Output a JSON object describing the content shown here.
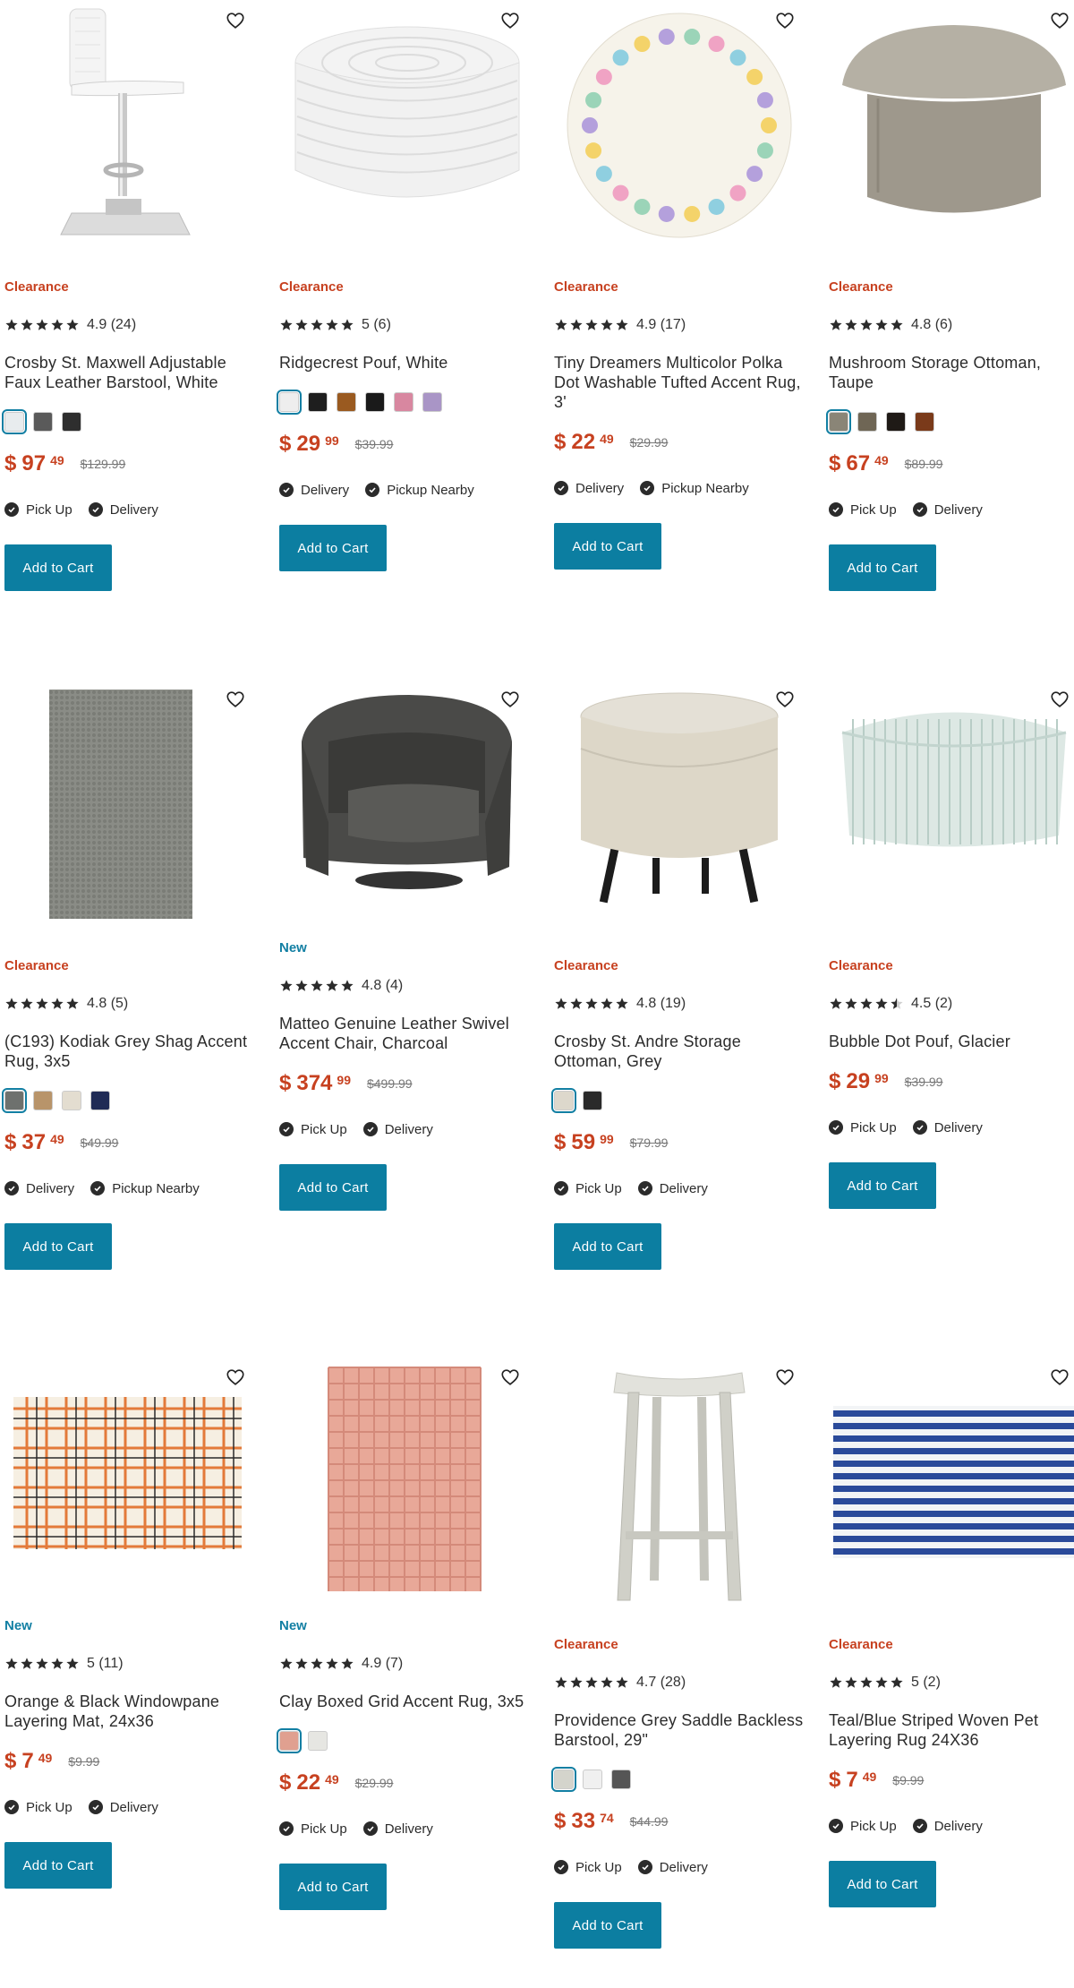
{
  "products": [
    {
      "badge": "Clearance",
      "badge_type": "clearance",
      "rating": "4.9 (24)",
      "stars": 5,
      "title": "Crosby St. Maxwell Adjustable Faux Leather Barstool, White",
      "swatches": [
        "#e8ecee",
        "#5a5a5a",
        "#2e2e2e"
      ],
      "price_dollar": "$",
      "price_whole": "97",
      "price_cents": "49",
      "was_price": "$129.99",
      "fulfillment": [
        "Pick Up",
        "Delivery"
      ],
      "cart_label": "Add to Cart",
      "image": "barstool-white"
    },
    {
      "badge": "Clearance",
      "badge_type": "clearance",
      "rating": "5 (6)",
      "stars": 5,
      "title": "Ridgecrest Pouf, White",
      "swatches": [
        "#eeeeee",
        "#1e1e1e",
        "#9a5a20",
        "#1a1a1a",
        "#d887a0",
        "#a995c6"
      ],
      "price_dollar": "$",
      "price_whole": "29",
      "price_cents": "99",
      "was_price": "$39.99",
      "fulfillment": [
        "Delivery",
        "Pickup Nearby"
      ],
      "cart_label": "Add to Cart",
      "image": "pouf-white"
    },
    {
      "badge": "Clearance",
      "badge_type": "clearance",
      "rating": "4.9 (17)",
      "stars": 5,
      "title": "Tiny Dreamers Multicolor Polka Dot Washable Tufted Accent Rug, 3'",
      "swatches": [],
      "price_dollar": "$",
      "price_whole": "22",
      "price_cents": "49",
      "was_price": "$29.99",
      "fulfillment": [
        "Delivery",
        "Pickup Nearby"
      ],
      "cart_label": "Add to Cart",
      "image": "rug-polka"
    },
    {
      "badge": "Clearance",
      "badge_type": "clearance",
      "rating": "4.8 (6)",
      "stars": 5,
      "title": "Mushroom Storage Ottoman, Taupe",
      "swatches": [
        "#8a8577",
        "#6f6655",
        "#1f1a16",
        "#7a3a1a"
      ],
      "price_dollar": "$",
      "price_whole": "67",
      "price_cents": "49",
      "was_price": "$89.99",
      "fulfillment": [
        "Pick Up",
        "Delivery"
      ],
      "cart_label": "Add to Cart",
      "image": "ottoman-mushroom"
    },
    {
      "badge": "Clearance",
      "badge_type": "clearance",
      "rating": "4.8 (5)",
      "stars": 5,
      "title": "(C193) Kodiak Grey Shag Accent Rug, 3x5",
      "swatches": [
        "#6e716e",
        "#b8946a",
        "#e3ddd0",
        "#1f2b55"
      ],
      "price_dollar": "$",
      "price_whole": "37",
      "price_cents": "49",
      "was_price": "$49.99",
      "fulfillment": [
        "Delivery",
        "Pickup Nearby"
      ],
      "cart_label": "Add to Cart",
      "image": "rug-shag"
    },
    {
      "badge": "New",
      "badge_type": "new",
      "rating": "4.8 (4)",
      "stars": 5,
      "title": "Matteo Genuine Leather Swivel Accent Chair, Charcoal",
      "swatches": [],
      "price_dollar": "$",
      "price_whole": "374",
      "price_cents": "99",
      "was_price": "$499.99",
      "fulfillment": [
        "Pick Up",
        "Delivery"
      ],
      "cart_label": "Add to Cart",
      "image": "chair-leather"
    },
    {
      "badge": "Clearance",
      "badge_type": "clearance",
      "rating": "4.8 (19)",
      "stars": 5,
      "title": "Crosby St. Andre Storage Ottoman, Grey",
      "swatches": [
        "#ddd8cc",
        "#2a2a2a"
      ],
      "price_dollar": "$",
      "price_whole": "59",
      "price_cents": "99",
      "was_price": "$79.99",
      "fulfillment": [
        "Pick Up",
        "Delivery"
      ],
      "cart_label": "Add to Cart",
      "image": "ottoman-andre"
    },
    {
      "badge": "Clearance",
      "badge_type": "clearance",
      "rating": "4.5 (2)",
      "stars": 4.5,
      "title": "Bubble Dot Pouf, Glacier",
      "swatches": [],
      "price_dollar": "$",
      "price_whole": "29",
      "price_cents": "99",
      "was_price": "$39.99",
      "fulfillment": [
        "Pick Up",
        "Delivery"
      ],
      "cart_label": "Add to Cart",
      "image": "pouf-glacier"
    },
    {
      "badge": "New",
      "badge_type": "new",
      "rating": "5 (11)",
      "stars": 5,
      "title": "Orange & Black Windowpane Layering Mat, 24x36",
      "swatches": [],
      "price_dollar": "$",
      "price_whole": "7",
      "price_cents": "49",
      "was_price": "$9.99",
      "fulfillment": [
        "Pick Up",
        "Delivery"
      ],
      "cart_label": "Add to Cart",
      "image": "mat-windowpane"
    },
    {
      "badge": "New",
      "badge_type": "new",
      "rating": "4.9 (7)",
      "stars": 5,
      "title": "Clay Boxed Grid Accent Rug, 3x5",
      "swatches": [
        "#e0a090",
        "#e6e6e2"
      ],
      "price_dollar": "$",
      "price_whole": "22",
      "price_cents": "49",
      "was_price": "$29.99",
      "fulfillment": [
        "Pick Up",
        "Delivery"
      ],
      "cart_label": "Add to Cart",
      "image": "rug-clay"
    },
    {
      "badge": "Clearance",
      "badge_type": "clearance",
      "rating": "4.7 (28)",
      "stars": 5,
      "title": "Providence Grey Saddle Backless Barstool, 29\"",
      "swatches": [
        "#d4d4cc",
        "#f0f0f0",
        "#555555"
      ],
      "price_dollar": "$",
      "price_whole": "33",
      "price_cents": "74",
      "was_price": "$44.99",
      "fulfillment": [
        "Pick Up",
        "Delivery"
      ],
      "cart_label": "Add to Cart",
      "image": "barstool-saddle"
    },
    {
      "badge": "Clearance",
      "badge_type": "clearance",
      "rating": "5 (2)",
      "stars": 5,
      "title": "Teal/Blue Striped Woven Pet Layering Rug 24X36",
      "swatches": [],
      "price_dollar": "$",
      "price_whole": "7",
      "price_cents": "49",
      "was_price": "$9.99",
      "fulfillment": [
        "Pick Up",
        "Delivery"
      ],
      "cart_label": "Add to Cart",
      "image": "rug-striped"
    }
  ],
  "colors": {
    "clearance": "#c74120",
    "new": "#127fa3",
    "button": "#0c7ea1",
    "price": "#c74120"
  }
}
